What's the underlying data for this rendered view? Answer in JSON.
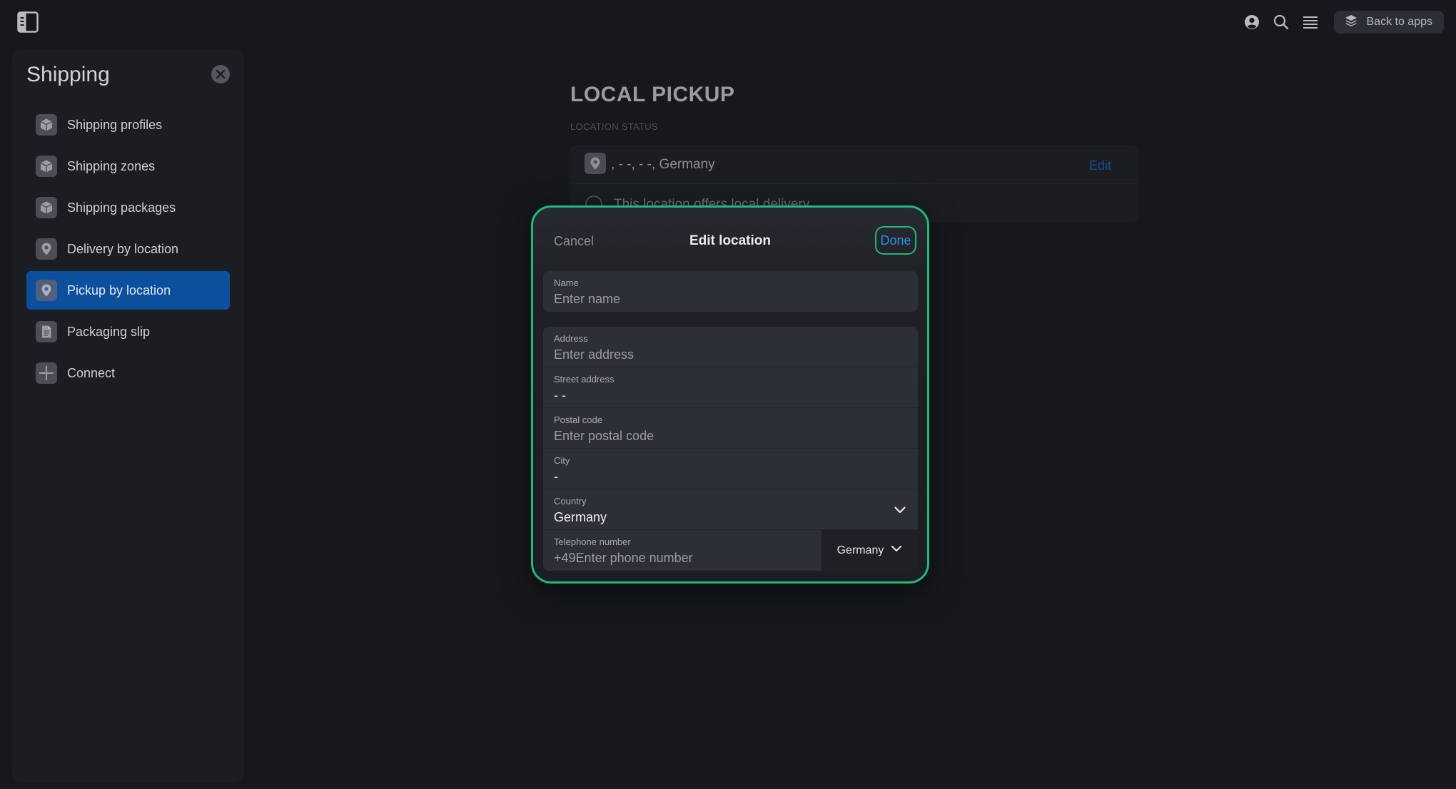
{
  "topbar": {
    "back_to_apps": "Back to apps"
  },
  "sidebar": {
    "title": "Shipping",
    "items": [
      {
        "label": "Shipping profiles",
        "icon": "box-icon",
        "active": false
      },
      {
        "label": "Shipping zones",
        "icon": "box-icon",
        "active": false
      },
      {
        "label": "Shipping packages",
        "icon": "box-icon",
        "active": false
      },
      {
        "label": "Delivery by location",
        "icon": "location-pin-icon",
        "active": false
      },
      {
        "label": "Pickup by location",
        "icon": "location-pin-icon",
        "active": true
      },
      {
        "label": "Packaging slip",
        "icon": "document-icon",
        "active": false
      },
      {
        "label": "Connect",
        "icon": "plus-icon",
        "active": false
      }
    ]
  },
  "main": {
    "title": "LOCAL PICKUP",
    "section_label": "LOCATION STATUS",
    "location_text": ", - -, - -, Germany",
    "edit_label": "Edit",
    "local_delivery_label": "This location offers local delivery"
  },
  "modal": {
    "title": "Edit location",
    "cancel_label": "Cancel",
    "done_label": "Done",
    "name_field": {
      "label": "Name",
      "value": "",
      "placeholder": "Enter name"
    },
    "address_field": {
      "label": "Address",
      "value": "",
      "placeholder": "Enter address"
    },
    "street_field": {
      "label": "Street address",
      "value": "- -"
    },
    "postal_field": {
      "label": "Postal code",
      "value": "",
      "placeholder": "Enter postal code"
    },
    "city_field": {
      "label": "City",
      "value": "-"
    },
    "country_field": {
      "label": "Country",
      "value": "Germany"
    },
    "phone_field": {
      "label": "Telephone number",
      "prefix": "+49",
      "placeholder": "Enter phone number",
      "country": "Germany"
    }
  },
  "colors": {
    "accent_green": "#20b87c",
    "active_blue": "#0c4f9d",
    "link_blue": "#2c8fe8"
  }
}
